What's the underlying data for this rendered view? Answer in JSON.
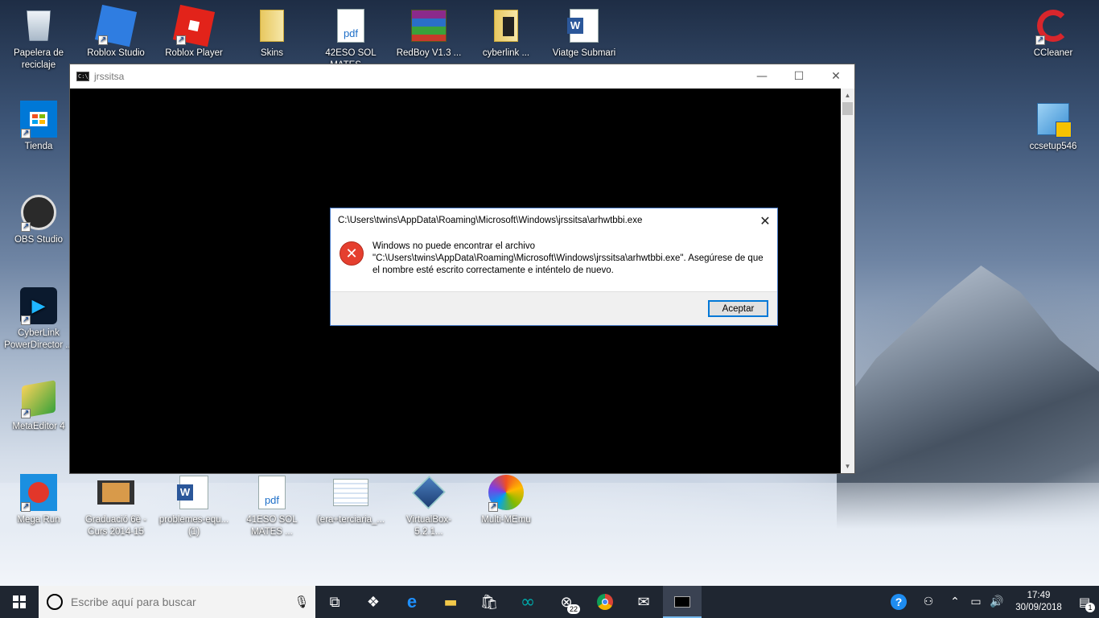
{
  "desktop": {
    "icons": [
      {
        "label": "Papelera de reciclaje"
      },
      {
        "label": "Roblox Studio"
      },
      {
        "label": "Roblox Player"
      },
      {
        "label": "Skins"
      },
      {
        "label": "42ESO SOL MATES ..."
      },
      {
        "label": "RedBoy V1.3 ..."
      },
      {
        "label": "cyberlink ..."
      },
      {
        "label": "Viatge Submari ..."
      },
      {
        "label": "CCleaner"
      },
      {
        "label": "Tienda"
      },
      {
        "label": "ccsetup546"
      },
      {
        "label": "OBS Studio"
      },
      {
        "label": "CyberLink PowerDirector ..."
      },
      {
        "label": "MetaEditor 4"
      },
      {
        "label": "Mega Run"
      },
      {
        "label": "Graduació 6è - Curs 2014-15"
      },
      {
        "label": "problemes-equ... (1)"
      },
      {
        "label": "41ESO SOL MATES ..."
      },
      {
        "label": "(era+terciaria_..."
      },
      {
        "label": "VirtualBox-5.2.1..."
      },
      {
        "label": "Multi-MEmu"
      }
    ],
    "pdf_text": "pdf"
  },
  "console": {
    "title": "jrssitsa",
    "icon_text": "C:\\_",
    "minimize": "—",
    "maximize": "☐",
    "close": "✕"
  },
  "dialog": {
    "title": "C:\\Users\\twins\\AppData\\Roaming\\Microsoft\\Windows\\jrssitsa\\arhwtbbi.exe",
    "message": "Windows no puede encontrar el archivo \"C:\\Users\\twins\\AppData\\Roaming\\Microsoft\\Windows\\jrssitsa\\arhwtbbi.exe\". Asegúrese de que el nombre esté escrito correctamente e inténtelo de nuevo.",
    "ok_label": "Aceptar",
    "close": "✕",
    "error_glyph": "✕"
  },
  "taskbar": {
    "search_placeholder": "Escribe aquí para buscar",
    "xbox_badge": "22",
    "clock_time": "17:49",
    "clock_date": "30/09/2018",
    "notifications_count": "1",
    "help_glyph": "?"
  },
  "colors": {
    "taskbar_bg": "#1f2631",
    "dialog_border": "#4a7cc8",
    "error_red": "#e53f2f",
    "accent_blue": "#0078d7"
  }
}
